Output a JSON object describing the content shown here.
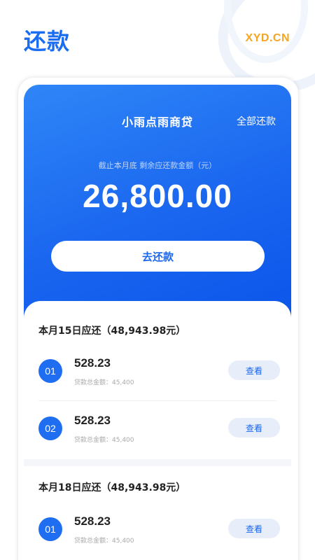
{
  "header": {
    "title": "还款",
    "brand": "XYD.CN"
  },
  "hero": {
    "product_name": "小雨点雨商贷",
    "action_label": "全部还款",
    "subtitle": "截止本月底 剩余应还款金额（元）",
    "amount": "26,800.00",
    "button_label": "去还款"
  },
  "sections": [
    {
      "title": "本月15日应还（48,943.98元）",
      "items": [
        {
          "index": "01",
          "amount": "528.23",
          "total": "贷款总金额：45,400",
          "button": "查看"
        },
        {
          "index": "02",
          "amount": "528.23",
          "total": "贷款总金额：45,400",
          "button": "查看"
        }
      ]
    },
    {
      "title": "本月18日应还（48,943.98元）",
      "items": [
        {
          "index": "01",
          "amount": "528.23",
          "total": "贷款总金额：45,400",
          "button": "查看"
        }
      ]
    }
  ],
  "colors": {
    "primary": "#1a66ef",
    "brand": "#f5a623"
  }
}
